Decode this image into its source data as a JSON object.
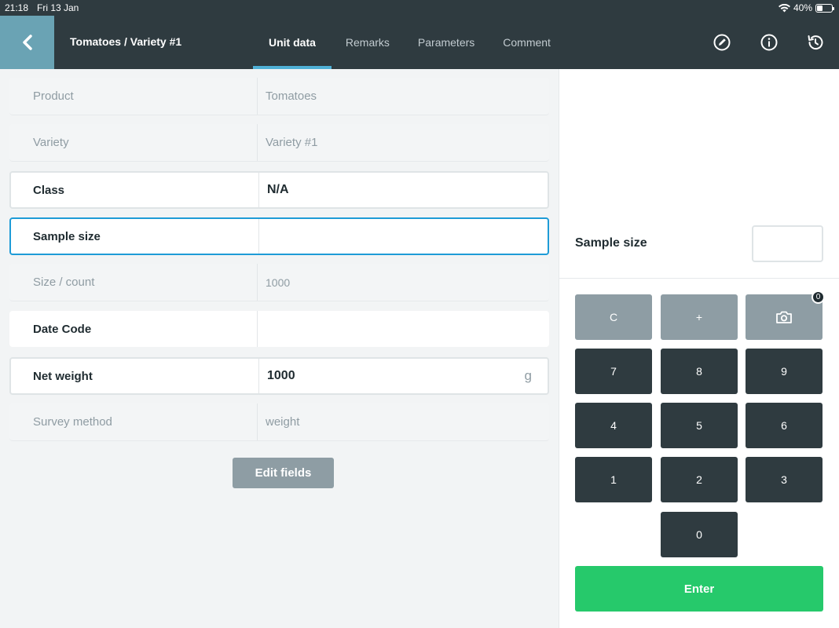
{
  "status_bar": {
    "time": "21:18",
    "date": "Fri 13 Jan",
    "battery_text": "40%",
    "battery_level": 0.4
  },
  "header": {
    "title": "Tomatoes / Variety #1",
    "tabs": [
      {
        "label": "Unit data",
        "active": true
      },
      {
        "label": "Remarks",
        "active": false
      },
      {
        "label": "Parameters",
        "active": false
      },
      {
        "label": "Comment",
        "active": false
      }
    ],
    "icons": [
      "back-icon",
      "edit-icon",
      "info-icon",
      "history-icon"
    ]
  },
  "form": {
    "rows": [
      {
        "label": "Product",
        "value": "Tomatoes"
      },
      {
        "label": "Variety",
        "value": "Variety #1"
      },
      {
        "label": "Class",
        "value": "N/A"
      },
      {
        "label": "Sample size",
        "value": ""
      },
      {
        "label": "Size / count",
        "value": "1000"
      },
      {
        "label": "Date Code",
        "value": ""
      },
      {
        "label": "Net weight",
        "value": "1000",
        "unit": "g"
      },
      {
        "label": "Survey method",
        "value": "weight"
      }
    ],
    "edit_fields_label": "Edit fields"
  },
  "keypad": {
    "field_label": "Sample size",
    "field_value": "",
    "clear": "C",
    "plus": "+",
    "photo_count": "0",
    "digits": [
      "7",
      "8",
      "9",
      "4",
      "5",
      "6",
      "1",
      "2",
      "3",
      "0"
    ],
    "enter": "Enter"
  },
  "colors": {
    "header_bg": "#2f3b40",
    "accent": "#1e9bd7",
    "enter": "#26c96b",
    "back_bg": "#6aa3b4"
  }
}
